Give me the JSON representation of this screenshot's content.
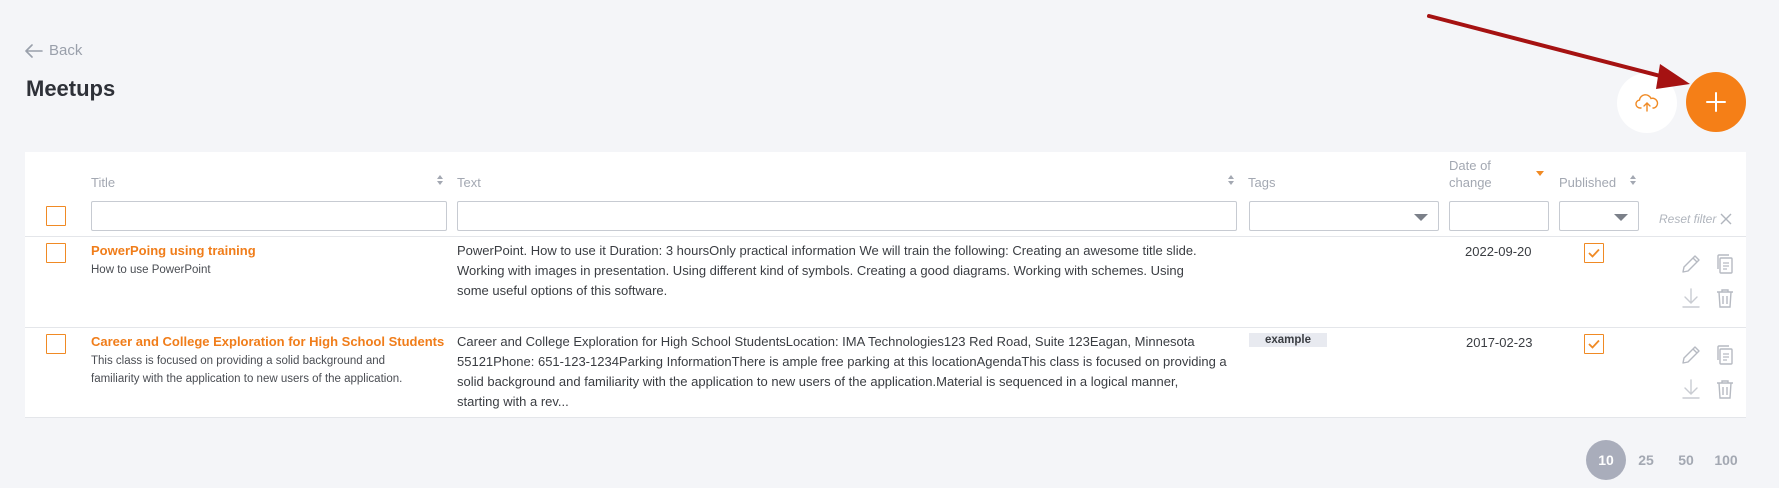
{
  "nav": {
    "back_label": "Back"
  },
  "page": {
    "title": "Meetups"
  },
  "actions": {
    "upload_icon": "cloud-upload-icon",
    "add_icon": "plus-icon",
    "accent": "#f57f17"
  },
  "table": {
    "columns": {
      "title": "Title",
      "text": "Text",
      "tags": "Tags",
      "date_line1": "Date of",
      "date_line2": "change",
      "published": "Published"
    },
    "filters": {
      "title_value": "",
      "text_value": "",
      "tags_value": "",
      "date_value": "",
      "published_value": ""
    },
    "reset_filter_label": "Reset filter",
    "rows": [
      {
        "title": "PowerPoing using training",
        "subtitle": "How to use PowerPoint",
        "text_line1": "PowerPoint. How to use it Duration: 3 hoursOnly practical information We will train the following: Creating an awesome title slide.",
        "text_line2": "Working with images in presentation. Using different kind of symbols. Creating a good diagrams. Working with schemes. Using",
        "text_line3": "some useful options of this software.",
        "tag": "",
        "date": "2022-09-20",
        "published": true
      },
      {
        "title": "Career and College Exploration for High School Students",
        "subtitle_line1": "This class is focused on providing a solid background and",
        "subtitle_line2": "familiarity with the application to new users of the application.",
        "text_line1": "Career and College Exploration for High School StudentsLocation: IMA Technologies123 Red Road, Suite 123Eagan, Minnesota",
        "text_line2": "55121Phone: 651-123-1234Parking InformationThere is ample free parking at this locationAgendaThis class is focused on providing a",
        "text_line3": "solid background and familiarity with the application to new users of the application.Material is sequenced in a logical manner,",
        "text_line4": "starting with a rev...",
        "tag": "example",
        "date": "2017-02-23",
        "published": true
      }
    ]
  },
  "pagination": {
    "options": [
      "10",
      "25",
      "50",
      "100"
    ],
    "active": "10"
  }
}
